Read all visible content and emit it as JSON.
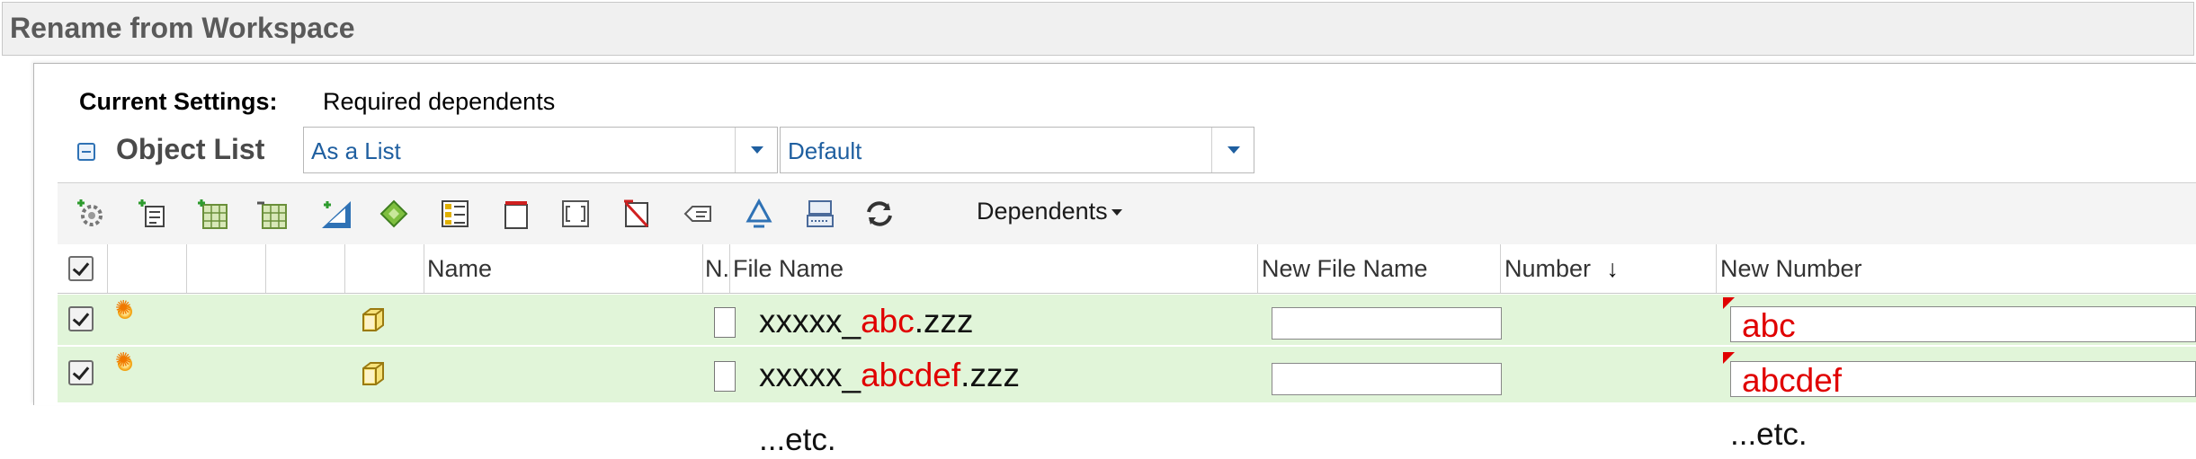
{
  "window": {
    "title": "Rename from Workspace"
  },
  "settings": {
    "label": "Current Settings:",
    "value": "Required dependents"
  },
  "object_list": {
    "label": "Object List",
    "view_dropdown": {
      "value": "As a List"
    },
    "layout_dropdown": {
      "value": "Default"
    }
  },
  "toolbar": {
    "icons": [
      "settings-icon",
      "tree-structure-icon",
      "add-table-icon",
      "remove-table-icon",
      "pen-measure-icon",
      "tag-icon",
      "table-view-icon",
      "rectangle-icon",
      "bracket-box-icon",
      "red-flag-icon",
      "comment-icon",
      "recycle-icon",
      "server-icon",
      "refresh-icon"
    ],
    "dependents_label": "Dependents"
  },
  "table": {
    "headers": {
      "name": "Name",
      "n": "N.",
      "file_name": "File Name",
      "new_file_name": "New File Name",
      "number": "Number",
      "number_sort": "↓",
      "new_number": "New Number"
    },
    "rows": [
      {
        "file_prefix": "xxxxx_",
        "file_highlight": "abc",
        "file_suffix": ".zzz",
        "new_file_name": "",
        "new_number": "abc",
        "checked": true
      },
      {
        "file_prefix": "xxxxx_",
        "file_highlight": "abcdef",
        "file_suffix": ".zzz",
        "new_file_name": "",
        "new_number": "abcdef",
        "checked": true
      }
    ],
    "etc_file": "...etc.",
    "etc_number": "...etc."
  },
  "colors": {
    "row_bg": "#e1f5d9",
    "highlight": "#e00000",
    "dropdown_text": "#1f5fa0"
  }
}
